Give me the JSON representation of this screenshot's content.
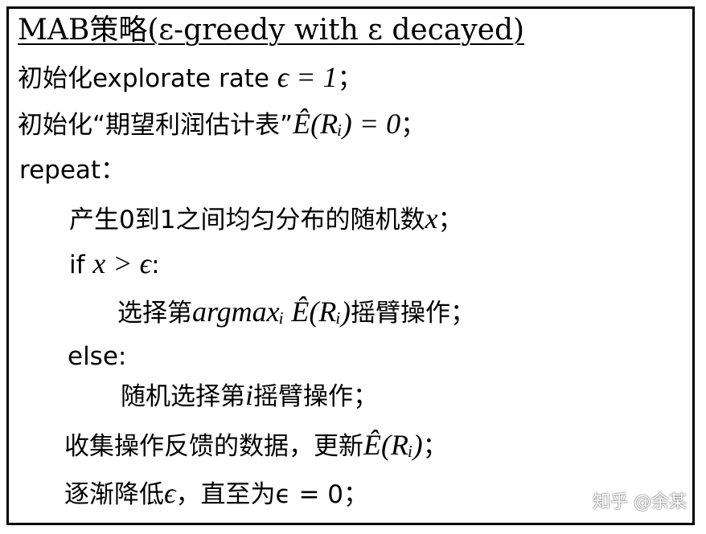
{
  "title": "MAB策略(ε-greedy with ε decayed)",
  "lines": [
    {
      "pre": "初始化explorate rate ",
      "math": "ϵ = 1",
      "post": "；"
    },
    {
      "pre": "初始化“期望利润估计表”",
      "math": "Ê(Rᵢ) = 0",
      "post": "；"
    },
    {
      "pre": "repeat：",
      "math": "",
      "post": ""
    },
    {
      "pre": "产生0到1之间均匀分布的随机数",
      "math": "x",
      "post": "；"
    },
    {
      "pre": "if ",
      "math": "x > ϵ",
      "post": ":"
    },
    {
      "pre": "选择第",
      "math": "argmaxᵢ Ê(Rᵢ)",
      "post": "摇臂操作；"
    },
    {
      "pre": "else:",
      "math": "",
      "post": ""
    },
    {
      "pre": "随机选择第",
      "math": "i",
      "post": "摇臂操作；"
    },
    {
      "pre": "收集操作反馈的数据，更新",
      "math": "Ê(Rᵢ)",
      "post": "；"
    },
    {
      "pre": "逐渐降低",
      "math": "ϵ",
      "post": "，直至为ϵ = 0；"
    }
  ],
  "watermark": "知乎 @余某"
}
